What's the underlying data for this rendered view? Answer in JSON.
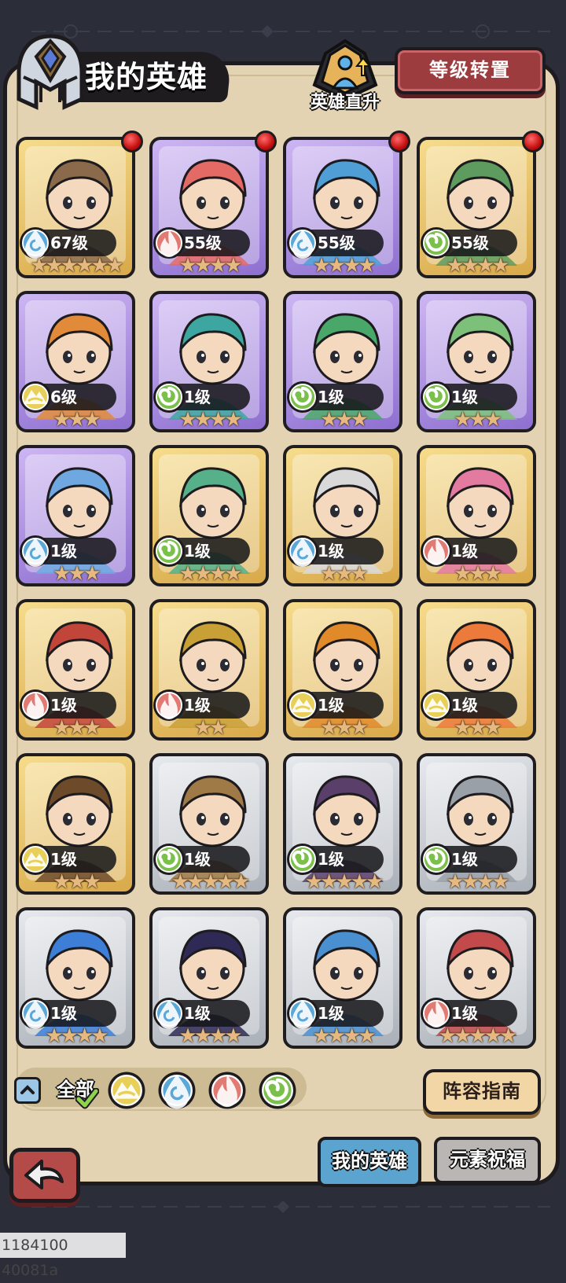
{
  "header": {
    "title": "我的英雄",
    "quick_upgrade_label": "英雄直升",
    "level_transfer_label": "等级转置"
  },
  "colors": {
    "water": "#5aa7d8",
    "fire": "#e07a72",
    "nature": "#7ac04a",
    "earth": "#e7cf5a",
    "gold_card": "#e8c56a",
    "purple_card": "#b99be8",
    "silver_card": "#cfd3d8"
  },
  "heroes": [
    {
      "level": "67级",
      "stars": "★★★★★★",
      "element": "water",
      "rarity": "gold",
      "alert": true,
      "portrait": "hooded-assassin"
    },
    {
      "level": "55级",
      "stars": "★★★★",
      "element": "fire",
      "rarity": "purple",
      "alert": true,
      "portrait": "rose-maiden"
    },
    {
      "level": "55级",
      "stars": "★★★★",
      "element": "water",
      "rarity": "purple",
      "alert": true,
      "portrait": "blue-haired-warrior"
    },
    {
      "level": "55级",
      "stars": "★★★★",
      "element": "nature",
      "rarity": "gold",
      "alert": true,
      "portrait": "green-haired-rogue"
    },
    {
      "level": "6级",
      "stars": "★★★",
      "element": "earth",
      "rarity": "purple",
      "alert": false,
      "portrait": "tiger-warrior"
    },
    {
      "level": "1级",
      "stars": "★★★★",
      "element": "nature",
      "rarity": "purple",
      "alert": false,
      "portrait": "teal-priestess"
    },
    {
      "level": "1级",
      "stars": "★★★",
      "element": "nature",
      "rarity": "purple",
      "alert": false,
      "portrait": "green-sorcerer"
    },
    {
      "level": "1级",
      "stars": "★★★",
      "element": "nature",
      "rarity": "purple",
      "alert": false,
      "portrait": "green-witch"
    },
    {
      "level": "1级",
      "stars": "★★★",
      "element": "water",
      "rarity": "purple",
      "alert": false,
      "portrait": "blue-elf-girl"
    },
    {
      "level": "1级",
      "stars": "★★★★",
      "element": "nature",
      "rarity": "gold",
      "alert": false,
      "portrait": "green-elf"
    },
    {
      "level": "1级",
      "stars": "★★★",
      "element": "water",
      "rarity": "gold",
      "alert": false,
      "portrait": "goggles-girl"
    },
    {
      "level": "1级",
      "stars": "★★★",
      "element": "fire",
      "rarity": "gold",
      "alert": false,
      "portrait": "pink-captain"
    },
    {
      "level": "1级",
      "stars": "★★★",
      "element": "fire",
      "rarity": "gold",
      "alert": false,
      "portrait": "red-braid-monocle"
    },
    {
      "level": "1级",
      "stars": "★★",
      "element": "fire",
      "rarity": "gold",
      "alert": false,
      "portrait": "golden-knight"
    },
    {
      "level": "1级",
      "stars": "★★★",
      "element": "earth",
      "rarity": "gold",
      "alert": false,
      "portrait": "bearded-warrior"
    },
    {
      "level": "1级",
      "stars": "★★★",
      "element": "earth",
      "rarity": "gold",
      "alert": false,
      "portrait": "orange-haired-girl"
    },
    {
      "level": "1级",
      "stars": "★★★",
      "element": "earth",
      "rarity": "gold",
      "alert": false,
      "portrait": "dreadlock-warrior"
    },
    {
      "level": "1级",
      "stars": "★★★★★",
      "element": "nature",
      "rarity": "silver",
      "alert": false,
      "portrait": "wooden-mask"
    },
    {
      "level": "1级",
      "stars": "★★★★★",
      "element": "nature",
      "rarity": "silver",
      "alert": false,
      "portrait": "horned-beast"
    },
    {
      "level": "1级",
      "stars": "★★★★",
      "element": "nature",
      "rarity": "silver",
      "alert": false,
      "portrait": "iron-knight"
    },
    {
      "level": "1级",
      "stars": "★★★★",
      "element": "water",
      "rarity": "silver",
      "alert": false,
      "portrait": "blue-bob-girl"
    },
    {
      "level": "1级",
      "stars": "★★★★",
      "element": "water",
      "rarity": "silver",
      "alert": false,
      "portrait": "dark-haired-lady"
    },
    {
      "level": "1级",
      "stars": "★★★★",
      "element": "water",
      "rarity": "silver",
      "alert": false,
      "portrait": "blue-dragon"
    },
    {
      "level": "1级",
      "stars": "★★★★★",
      "element": "fire",
      "rarity": "silver",
      "alert": false,
      "portrait": "red-elf-girl"
    }
  ],
  "filter": {
    "all_label": "全部",
    "elements": [
      "earth",
      "water",
      "fire",
      "nature"
    ]
  },
  "guide_label": "阵容指南",
  "tabs": [
    {
      "label": "我的英雄",
      "active": true
    },
    {
      "label": "元素祝福",
      "active": false
    }
  ],
  "watermark": "1184100 40081a"
}
